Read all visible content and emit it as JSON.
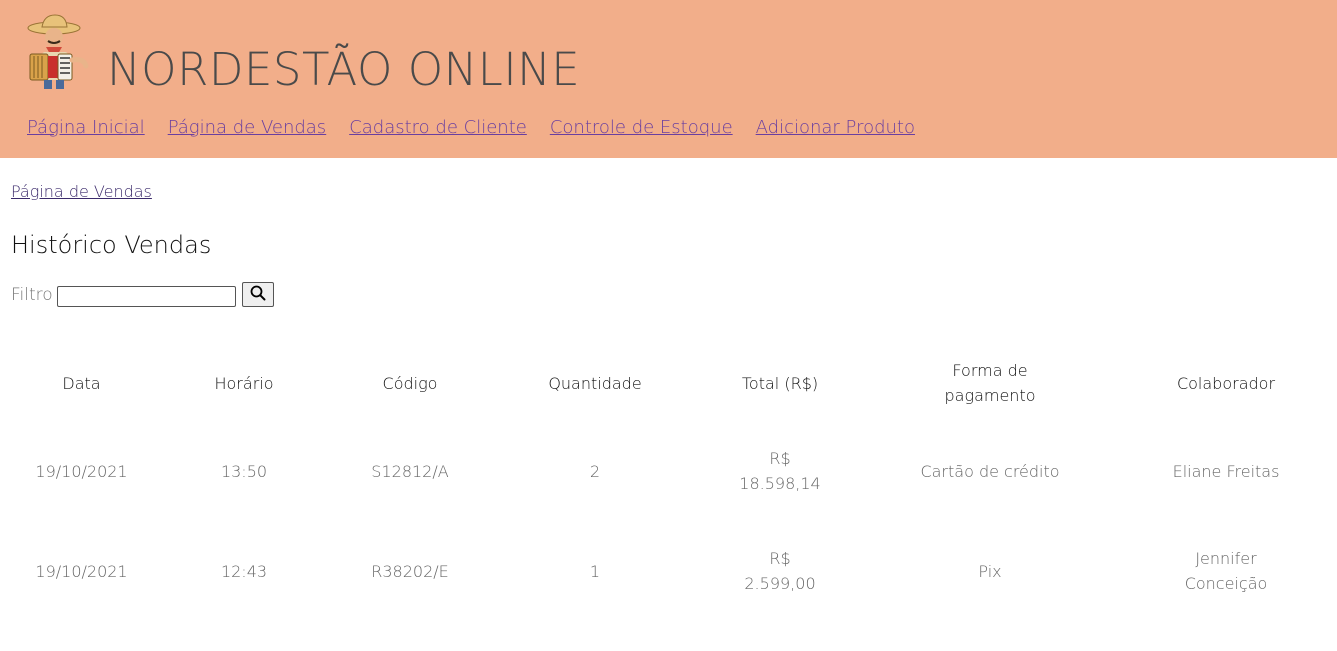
{
  "header": {
    "logo_icon": "accordion-player-icon",
    "title": "NORDESTÃO ONLINE",
    "background_color": "#f2ae8a",
    "nav": [
      {
        "label": "Página Inicial"
      },
      {
        "label": "Página de Vendas"
      },
      {
        "label": "Cadastro de Cliente"
      },
      {
        "label": "Controle de Estoque"
      },
      {
        "label": "Adicionar Produto"
      }
    ]
  },
  "breadcrumb": "Página de Vendas",
  "page_title": "Histórico Vendas",
  "filter": {
    "label": "Filtro",
    "value": "",
    "button_icon": "search-icon"
  },
  "table": {
    "headers": {
      "data": "Data",
      "horario": "Horário",
      "codigo": "Código",
      "quantidade": "Quantidade",
      "total": "Total (R$)",
      "forma_line1": "Forma de",
      "forma_line2": "pagamento",
      "colaborador": "Colaborador"
    },
    "rows": [
      {
        "data": "19/10/2021",
        "horario": "13:50",
        "codigo": "S12812/A",
        "quantidade": "2",
        "total_currency": "R$",
        "total_value": "18.598,14",
        "forma": "Cartão de crédito",
        "colaborador_line1": "Eliane Freitas",
        "colaborador_line2": ""
      },
      {
        "data": "19/10/2021",
        "horario": "12:43",
        "codigo": "R38202/E",
        "quantidade": "1",
        "total_currency": "R$",
        "total_value": "2.599,00",
        "forma": "Pix",
        "colaborador_line1": "Jennifer",
        "colaborador_line2": "Conceição"
      }
    ]
  }
}
